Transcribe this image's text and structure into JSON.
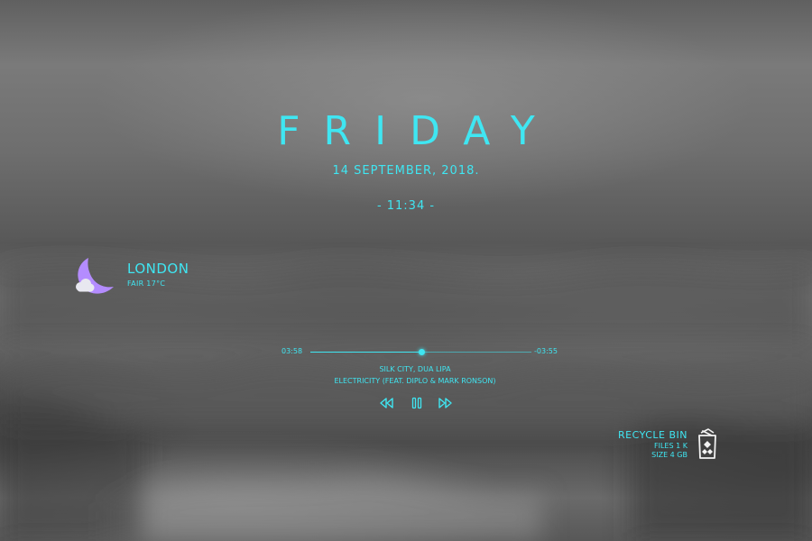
{
  "header": {
    "day": "FRIDAY",
    "date": "14 SEPTEMBER, 2018.",
    "time": "- 11:34 -"
  },
  "weather": {
    "city": "LONDON",
    "condition": "FAIR 17°C",
    "icon": "moon-cloud-icon"
  },
  "player": {
    "elapsed": "03:58",
    "remaining": "-03:55",
    "progress": 0.5,
    "artist": "SILK CITY, DUA LIPA",
    "title": "ELECTRICITY (FEAT. DIPLO & MARK RONSON)",
    "controls": [
      "rewind-icon",
      "pause-icon",
      "fast-forward-icon"
    ]
  },
  "recycle_bin": {
    "label": "RECYCLE BIN",
    "files": "FILES 1 K",
    "size": "SIZE 4 GB",
    "icon": "recycle-bin-icon"
  },
  "colors": {
    "accent": "#3fe6f2",
    "weather_icon": "#b48cff"
  }
}
